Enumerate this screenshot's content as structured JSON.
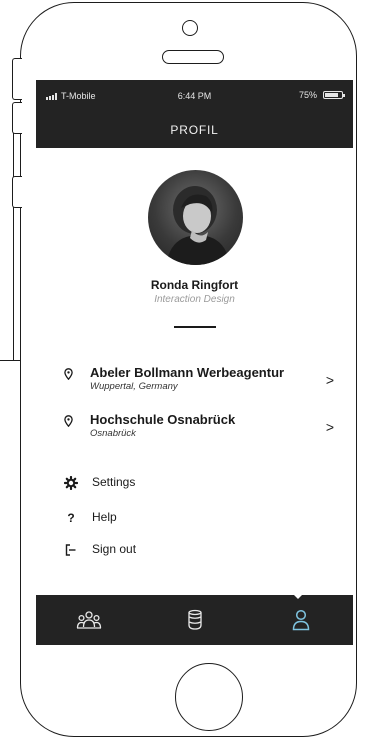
{
  "statusbar": {
    "carrier": "T-Mobile",
    "time": "6:44 PM",
    "battery": "75%"
  },
  "navbar": {
    "title": "PROFIL"
  },
  "profile": {
    "name": "Ronda Ringfort",
    "role": "Interaction Design"
  },
  "locations": [
    {
      "title": "Abeler Bollmann Werbeagentur",
      "subtitle": "Wuppertal, Germany",
      "icon": "location-pin-icon"
    },
    {
      "title": "Hochschule Osnabrück",
      "subtitle": "Osnabrück",
      "icon": "location-pin-icon"
    }
  ],
  "menu": [
    {
      "label": "Settings",
      "icon": "gear-icon"
    },
    {
      "label": "Help",
      "icon": "question-icon",
      "glyph": "?"
    },
    {
      "label": "Sign out",
      "icon": "sign-out-icon"
    }
  ],
  "tabs": [
    {
      "icon": "community-icon",
      "active": false
    },
    {
      "icon": "cup-icon",
      "active": false
    },
    {
      "icon": "user-icon",
      "active": true
    }
  ],
  "colors": {
    "dark": "#232323",
    "accent": "#7fc4e0",
    "icon_inactive": "#e9e9e9"
  }
}
